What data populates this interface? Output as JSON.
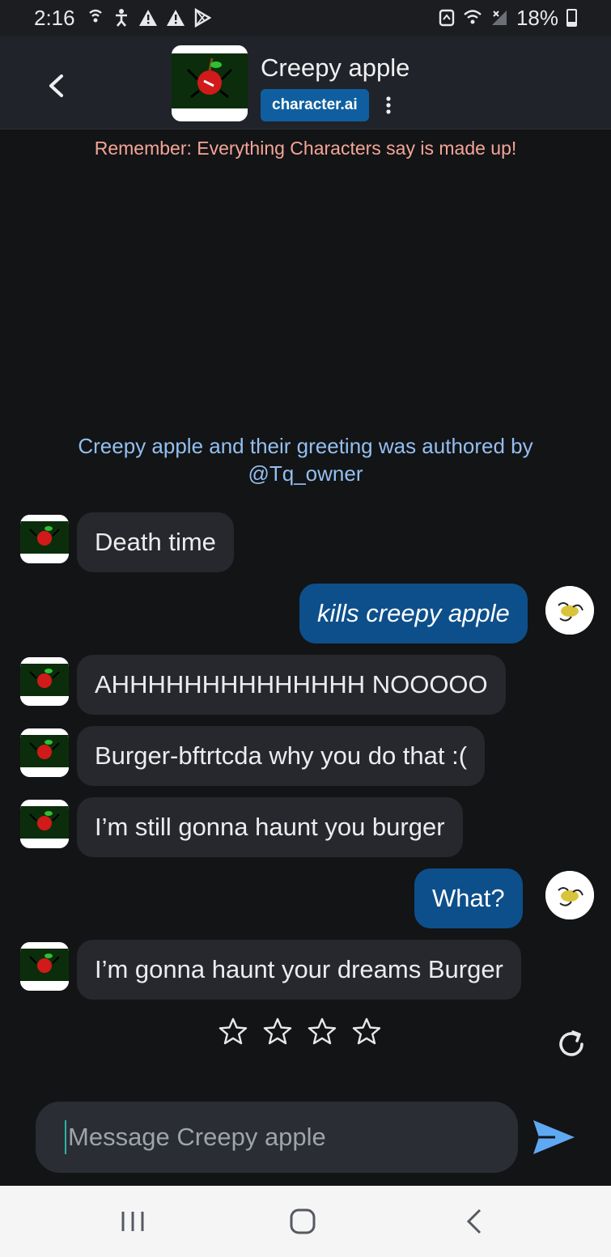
{
  "status_bar": {
    "time": "2:16",
    "battery": "18%"
  },
  "header": {
    "character_name": "Creepy apple",
    "brand": "character.ai"
  },
  "disclaimer": "Remember: Everything Characters say is made up!",
  "author_note": "Creepy apple and their greeting was authored by @Tq_owner",
  "messages": [
    {
      "sender": "bot",
      "text": "Death time"
    },
    {
      "sender": "user",
      "text": "kills creepy apple"
    },
    {
      "sender": "bot",
      "text": "AHHHHHHHHHHHHHH NOOOOO"
    },
    {
      "sender": "bot",
      "text": "Burger-bftrtcda why you do that :("
    },
    {
      "sender": "bot",
      "text": "I’m still gonna haunt you burger"
    },
    {
      "sender": "user",
      "text": "What?"
    },
    {
      "sender": "bot",
      "text": "I’m gonna haunt your dreams Burger"
    }
  ],
  "rating": {
    "stars_total": 4,
    "stars_filled": 0
  },
  "composer": {
    "placeholder": "Message Creepy apple",
    "value": ""
  },
  "colors": {
    "background": "#131416",
    "header": "#202329",
    "bot_bubble": "#26282d",
    "user_bubble": "#0d4f8b",
    "brand_badge": "#0f5fa0",
    "disclaimer": "#f4a597",
    "author_note": "#93bff0",
    "send_icon": "#5fa8f2"
  },
  "icons": {
    "back": "chevron-left-icon",
    "more": "kebab-menu-icon",
    "rate": "star-outline-icon",
    "regenerate": "refresh-icon",
    "send": "send-icon",
    "nav_recent": "recent-apps-icon",
    "nav_home": "home-icon",
    "nav_back": "back-icon"
  }
}
